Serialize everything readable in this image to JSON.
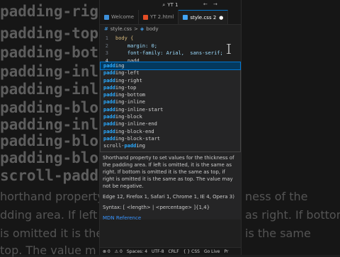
{
  "background": {
    "code_lines": [
      "padding-right",
      "padding-top",
      "padding-bottom",
      "padding-inline",
      "padding-inline",
      "padding-block",
      "padding-inline",
      "padding-block",
      "padding-block",
      "scroll-padding"
    ],
    "doc_lines": [
      "horthand property",
      "ness of the",
      "dding area. If left",
      "as right. If bottom",
      "is omitted it is the same",
      "is the same",
      "top. The value m"
    ]
  },
  "titlebar": {
    "search_text": "YT 1"
  },
  "tabs": [
    {
      "label": "Welcome",
      "active": false
    },
    {
      "label": "YT 2.html",
      "active": false
    },
    {
      "label": "style.css 2",
      "active": true,
      "dot": "●"
    }
  ],
  "breadcrumb": {
    "file": "style.css",
    "sep": ">",
    "symbol": "body"
  },
  "code": [
    {
      "n": "1",
      "text": "body {"
    },
    {
      "n": "2",
      "text": "    margin: 0;"
    },
    {
      "n": "3",
      "text": "    font-family: Arial,  sans-serif;"
    },
    {
      "n": "4",
      "text": "    padd"
    }
  ],
  "suggestions": [
    {
      "match": "padd",
      "rest": "ing"
    },
    {
      "match": "padd",
      "rest": "ing-left"
    },
    {
      "match": "padd",
      "rest": "ing-right"
    },
    {
      "match": "padd",
      "rest": "ing-top"
    },
    {
      "match": "padd",
      "rest": "ing-bottom"
    },
    {
      "match": "padd",
      "rest": "ing-inline"
    },
    {
      "match": "padd",
      "rest": "ing-inline-start"
    },
    {
      "match": "padd",
      "rest": "ing-block"
    },
    {
      "match": "padd",
      "rest": "ing-inline-end"
    },
    {
      "match": "padd",
      "rest": "ing-block-end"
    },
    {
      "match": "padd",
      "rest": "ing-block-start"
    },
    {
      "pre": "scroll-",
      "match": "padd",
      "rest": "ing"
    }
  ],
  "docs": {
    "description": "Shorthand property to set values for the thickness of the padding area. If left is omitted, it is the same as right. If bottom is omitted it is the same as top, if right is omitted it is the same as top. The value may not be negative.",
    "compat": "Edge 12, Firefox 1, Safari 1, Chrome 1, IE 4, Opera 3)",
    "syntax": "Syntax: [ <length> | <percentage> ]{1,4}",
    "reference": "MDN Reference"
  },
  "status": {
    "items": [
      "⊗ 0",
      "⚠ 0",
      "Spaces: 4",
      "UTF-8",
      "CRLF",
      "{ } CSS",
      "Go Live",
      "Pr"
    ]
  },
  "colors": {
    "accent": "#0078d4",
    "match": "#2aaaff",
    "link": "#3794ff"
  }
}
